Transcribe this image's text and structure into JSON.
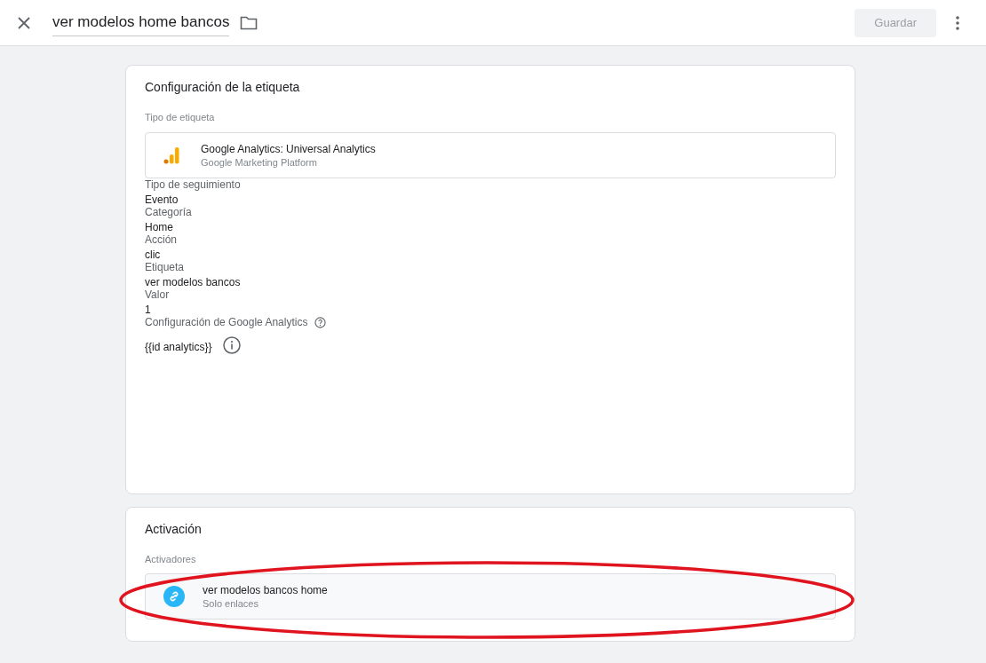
{
  "header": {
    "title": "ver modelos home bancos",
    "save_button": {
      "label": "Guardar",
      "disabled": true
    }
  },
  "tag_config": {
    "title": "Configuración de la etiqueta",
    "tag_type_label": "Tipo de etiqueta",
    "tag_type": {
      "name": "Google Analytics: Universal Analytics",
      "vendor": "Google Marketing Platform"
    },
    "fields": [
      {
        "label": "Tipo de seguimiento",
        "value": "Evento"
      },
      {
        "label": "Categoría",
        "value": "Home"
      },
      {
        "label": "Acción",
        "value": "clic"
      },
      {
        "label": "Etiqueta",
        "value": "ver modelos bancos"
      },
      {
        "label": "Valor",
        "value": "1"
      }
    ],
    "ga_settings": {
      "label": "Configuración de Google Analytics",
      "value": "{{id analytics}}"
    }
  },
  "triggering": {
    "title": "Activación",
    "triggers_label": "Activadores",
    "triggers": [
      {
        "name": "ver modelos bancos home",
        "type": "Solo enlaces"
      }
    ]
  }
}
